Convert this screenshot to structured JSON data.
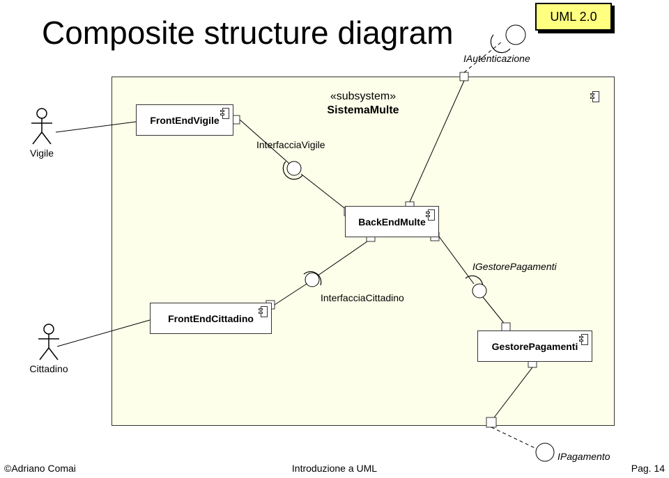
{
  "slide": {
    "title": "Composite structure diagram",
    "uml_tag": "UML 2.0"
  },
  "subsystem": {
    "stereotype": "«subsystem»",
    "name": "SistemaMulte"
  },
  "components": {
    "front_end_vigile": "FrontEndVigile",
    "back_end_multe": "BackEndMulte",
    "front_end_cittadino": "FrontEndCittadino",
    "gestore_pagamenti": "GestorePagamenti"
  },
  "interfaces": {
    "iautenticazione": "IAutenticazione",
    "interfaccia_vigile": "InterfacciaVigile",
    "interfaccia_cittadino": "InterfacciaCittadino",
    "igestore_pagamenti": "IGestorePagamenti",
    "ipagamento": "IPagamento"
  },
  "actors": {
    "vigile": "Vigile",
    "cittadino": "Cittadino"
  },
  "footer": {
    "left": "©Adriano Comai",
    "center": "Introduzione a UML",
    "right": "Pag. 14"
  }
}
